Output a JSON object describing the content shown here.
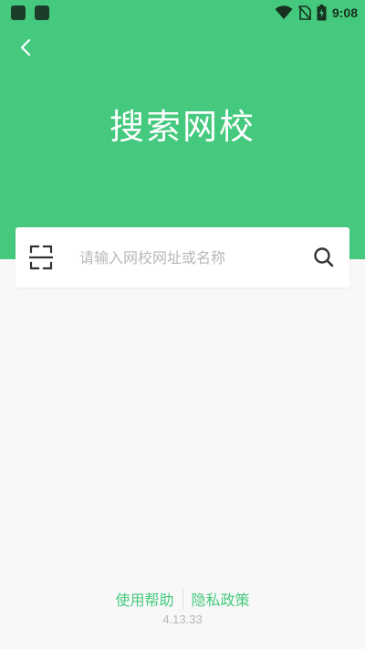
{
  "status_bar": {
    "time": "9:08",
    "icons": [
      "wifi-icon",
      "no-sim-icon",
      "battery-charging-icon"
    ]
  },
  "header": {
    "back_icon": "chevron-left-icon",
    "title": "搜索网校",
    "background_color": "#45c97e"
  },
  "search": {
    "placeholder": "请输入网校网址或名称",
    "value": "",
    "scan_icon": "scan-icon",
    "search_icon": "search-icon"
  },
  "footer": {
    "help_label": "使用帮助",
    "privacy_label": "隐私政策",
    "version": "4.13.33",
    "link_color": "#45c97e"
  }
}
